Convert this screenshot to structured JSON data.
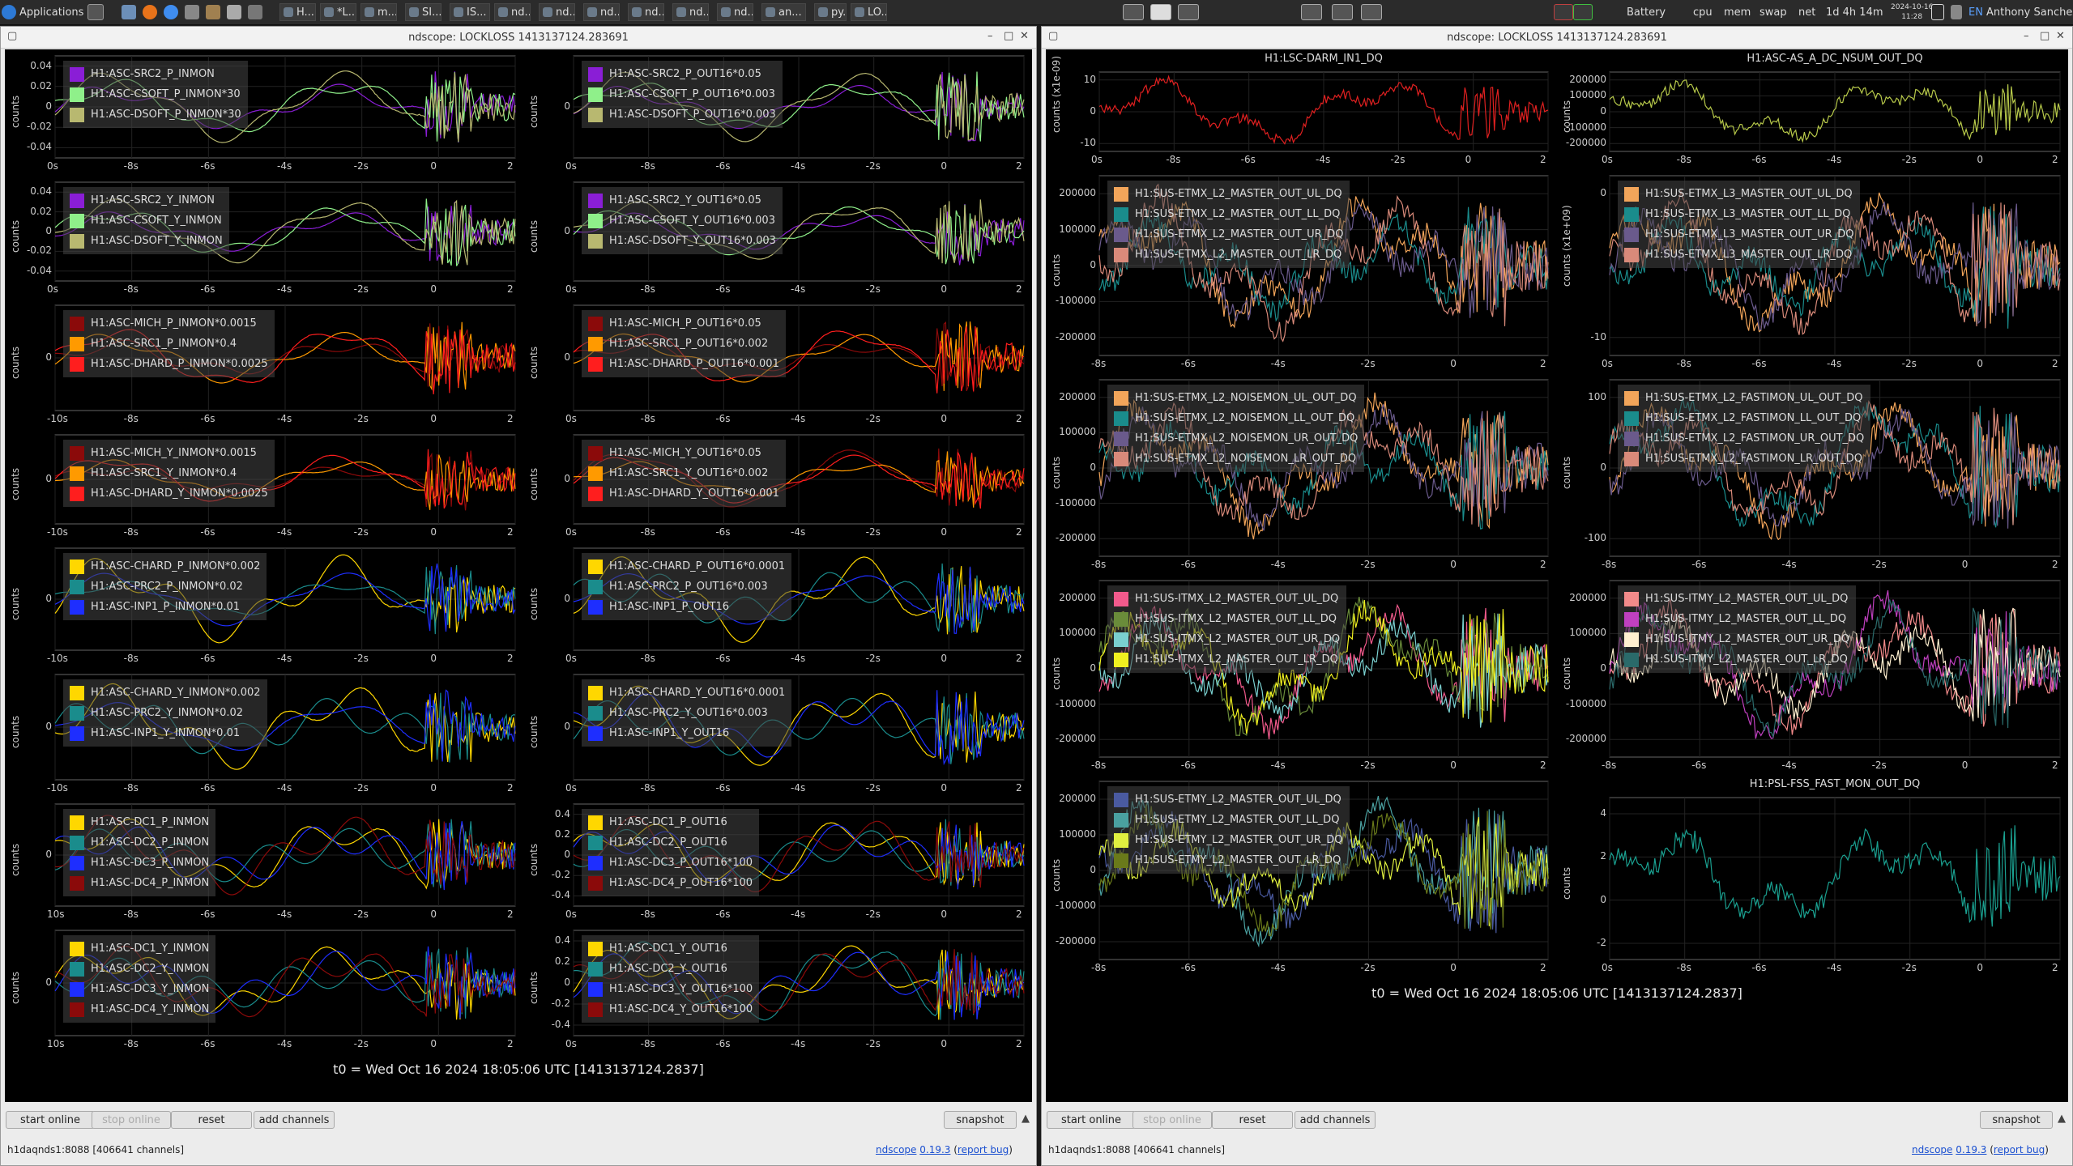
{
  "taskbar": {
    "apps_label": "Applications",
    "tasks": [
      "H...",
      "*L...",
      "m...",
      "SI...",
      "IS...",
      "nd...",
      "nd...",
      "nd...",
      "nd...",
      "nd...",
      "nd...",
      "an...",
      "py...",
      "LO..."
    ],
    "indicators": [
      "Battery",
      "cpu",
      "mem",
      "swap",
      "net"
    ],
    "uptime": "1d 4h 14m",
    "date": "2024-10-16",
    "time": "11:28",
    "lang": "EN",
    "user": "Anthony Sanchez"
  },
  "windows": [
    {
      "title": "ndscope: LOCKLOSS 1413137124.283691",
      "t0": "t0 = Wed Oct 16 2024 18:05:06 UTC [1413137124.2837]",
      "buttons": {
        "start": "start online",
        "stop": "stop online",
        "reset": "reset",
        "add": "add channels",
        "snapshot": "snapshot"
      },
      "status": {
        "server": "h1daqnds1:8088  [406641 channels]",
        "app": "ndscope",
        "version": "0.19.3",
        "report": "report bug"
      },
      "panels": [
        {
          "ylabel": "counts",
          "yticks": [
            "0.04",
            "0.02",
            "0",
            "-0.02",
            "-0.04"
          ],
          "xticks": [
            "0s",
            "-8s",
            "-6s",
            "-4s",
            "-2s",
            "0",
            "2"
          ],
          "legend": [
            "H1:ASC-SRC2_P_INMON",
            "H1:ASC-CSOFT_P_INMON*30",
            "H1:ASC-DSOFT_P_INMON*30"
          ],
          "colors": [
            "#8a1ed6",
            "#8ff08a",
            "#b8b870"
          ]
        },
        {
          "ylabel": "counts",
          "yticks": [
            "0"
          ],
          "xticks": [
            "0s",
            "-8s",
            "-6s",
            "-4s",
            "-2s",
            "0",
            "2"
          ],
          "legend": [
            "H1:ASC-SRC2_P_OUT16*0.05",
            "H1:ASC-CSOFT_P_OUT16*0.003",
            "H1:ASC-DSOFT_P_OUT16*0.003"
          ],
          "colors": [
            "#8a1ed6",
            "#8ff08a",
            "#b8b870"
          ]
        },
        {
          "ylabel": "counts",
          "yticks": [
            "0.04",
            "0.02",
            "0",
            "-0.02",
            "-0.04"
          ],
          "xticks": [
            "0s",
            "-8s",
            "-6s",
            "-4s",
            "-2s",
            "0",
            "2"
          ],
          "legend": [
            "H1:ASC-SRC2_Y_INMON",
            "H1:ASC-CSOFT_Y_INMON",
            "H1:ASC-DSOFT_Y_INMON"
          ],
          "colors": [
            "#8a1ed6",
            "#8ff08a",
            "#b8b870"
          ]
        },
        {
          "ylabel": "counts",
          "yticks": [
            "0"
          ],
          "xticks": [
            "0s",
            "-8s",
            "-6s",
            "-4s",
            "-2s",
            "0",
            "2"
          ],
          "legend": [
            "H1:ASC-SRC2_Y_OUT16*0.05",
            "H1:ASC-CSOFT_Y_OUT16*0.003",
            "H1:ASC-DSOFT_Y_OUT16*0.003"
          ],
          "colors": [
            "#8a1ed6",
            "#8ff08a",
            "#b8b870"
          ]
        },
        {
          "ylabel": "counts",
          "yticks": [
            "0"
          ],
          "xticks": [
            "-10s",
            "-8s",
            "-6s",
            "-4s",
            "-2s",
            "0",
            "2"
          ],
          "legend": [
            "H1:ASC-MICH_P_INMON*0.0015",
            "H1:ASC-SRC1_P_INMON*0.4",
            "H1:ASC-DHARD_P_INMON*0.0025"
          ],
          "colors": [
            "#8b0a0a",
            "#ff9a00",
            "#ff1e1e"
          ]
        },
        {
          "ylabel": "counts",
          "yticks": [
            "0"
          ],
          "xticks": [
            "0s",
            "-8s",
            "-6s",
            "-4s",
            "-2s",
            "0",
            "2"
          ],
          "legend": [
            "H1:ASC-MICH_P_OUT16*0.05",
            "H1:ASC-SRC1_P_OUT16*0.002",
            "H1:ASC-DHARD_P_OUT16*0.001"
          ],
          "colors": [
            "#8b0a0a",
            "#ff9a00",
            "#ff1e1e"
          ]
        },
        {
          "ylabel": "counts",
          "yticks": [
            "0"
          ],
          "xticks": [
            "-10s",
            "-8s",
            "-6s",
            "-4s",
            "-2s",
            "0",
            "2"
          ],
          "legend": [
            "H1:ASC-MICH_Y_INMON*0.0015",
            "H1:ASC-SRC1_Y_INMON*0.4",
            "H1:ASC-DHARD_Y_INMON*0.0025"
          ],
          "colors": [
            "#8b0a0a",
            "#ff9a00",
            "#ff1e1e"
          ]
        },
        {
          "ylabel": "counts",
          "yticks": [
            "0"
          ],
          "xticks": [
            "0s",
            "-8s",
            "-6s",
            "-4s",
            "-2s",
            "0",
            "2"
          ],
          "legend": [
            "H1:ASC-MICH_Y_OUT16*0.05",
            "H1:ASC-SRC1_Y_OUT16*0.002",
            "H1:ASC-DHARD_Y_OUT16*0.001"
          ],
          "colors": [
            "#8b0a0a",
            "#ff9a00",
            "#ff1e1e"
          ]
        },
        {
          "ylabel": "counts",
          "yticks": [
            "0"
          ],
          "xticks": [
            "-10s",
            "-8s",
            "-6s",
            "-4s",
            "-2s",
            "0",
            "2"
          ],
          "legend": [
            "H1:ASC-CHARD_P_INMON*0.002",
            "H1:ASC-PRC2_P_INMON*0.02",
            "H1:ASC-INP1_P_INMON*0.01"
          ],
          "colors": [
            "#ffd700",
            "#1a8c8c",
            "#1e2eff"
          ]
        },
        {
          "ylabel": "counts",
          "yticks": [
            "0"
          ],
          "xticks": [
            "0s",
            "-8s",
            "-6s",
            "-4s",
            "-2s",
            "0",
            "2"
          ],
          "legend": [
            "H1:ASC-CHARD_P_OUT16*0.0001",
            "H1:ASC-PRC2_P_OUT16*0.003",
            "H1:ASC-INP1_P_OUT16"
          ],
          "colors": [
            "#ffd700",
            "#1a8c8c",
            "#1e2eff"
          ]
        },
        {
          "ylabel": "counts",
          "yticks": [
            "0"
          ],
          "xticks": [
            "-10s",
            "-8s",
            "-6s",
            "-4s",
            "-2s",
            "0",
            "2"
          ],
          "legend": [
            "H1:ASC-CHARD_Y_INMON*0.002",
            "H1:ASC-PRC2_Y_INMON*0.02",
            "H1:ASC-INP1_Y_INMON*0.01"
          ],
          "colors": [
            "#ffd700",
            "#1a8c8c",
            "#1e2eff"
          ]
        },
        {
          "ylabel": "counts",
          "yticks": [
            "0"
          ],
          "xticks": [
            "0s",
            "-8s",
            "-6s",
            "-4s",
            "-2s",
            "0",
            "2"
          ],
          "legend": [
            "H1:ASC-CHARD_Y_OUT16*0.0001",
            "H1:ASC-PRC2_Y_OUT16*0.003",
            "H1:ASC-INP1_Y_OUT16"
          ],
          "colors": [
            "#ffd700",
            "#1a8c8c",
            "#1e2eff"
          ]
        },
        {
          "ylabel": "counts",
          "yticks": [
            "0"
          ],
          "xticks": [
            "10s",
            "-8s",
            "-6s",
            "-4s",
            "-2s",
            "0",
            "2"
          ],
          "legend": [
            "H1:ASC-DC1_P_INMON",
            "H1:ASC-DC2_P_INMON",
            "H1:ASC-DC3_P_INMON",
            "H1:ASC-DC4_P_INMON"
          ],
          "colors": [
            "#ffd700",
            "#1a8c8c",
            "#1e2eff",
            "#8b0a0a"
          ]
        },
        {
          "ylabel": "counts",
          "yticks": [
            "0.4",
            "0.2",
            "0",
            "-0.2",
            "-0.4"
          ],
          "xticks": [
            "0s",
            "-8s",
            "-6s",
            "-4s",
            "-2s",
            "0",
            "2"
          ],
          "legend": [
            "H1:ASC-DC1_P_OUT16",
            "H1:ASC-DC2_P_OUT16",
            "H1:ASC-DC3_P_OUT16*100",
            "H1:ASC-DC4_P_OUT16*100"
          ],
          "colors": [
            "#ffd700",
            "#1a8c8c",
            "#1e2eff",
            "#8b0a0a"
          ]
        },
        {
          "ylabel": "counts",
          "yticks": [
            "0"
          ],
          "xticks": [
            "10s",
            "-8s",
            "-6s",
            "-4s",
            "-2s",
            "0",
            "2"
          ],
          "legend": [
            "H1:ASC-DC1_Y_INMON",
            "H1:ASC-DC2_Y_INMON",
            "H1:ASC-DC3_Y_INMON",
            "H1:ASC-DC4_Y_INMON"
          ],
          "colors": [
            "#ffd700",
            "#1a8c8c",
            "#1e2eff",
            "#8b0a0a"
          ]
        },
        {
          "ylabel": "counts",
          "yticks": [
            "0.4",
            "0.2",
            "0",
            "-0.2",
            "-0.4"
          ],
          "xticks": [
            "0s",
            "-8s",
            "-6s",
            "-4s",
            "-2s",
            "0",
            "2"
          ],
          "legend": [
            "H1:ASC-DC1_Y_OUT16",
            "H1:ASC-DC2_Y_OUT16",
            "H1:ASC-DC3_Y_OUT16*100",
            "H1:ASC-DC4_Y_OUT16*100"
          ],
          "colors": [
            "#ffd700",
            "#1a8c8c",
            "#1e2eff",
            "#8b0a0a"
          ]
        }
      ]
    },
    {
      "title": "ndscope: LOCKLOSS 1413137124.283691",
      "t0": "t0 = Wed Oct 16 2024 18:05:06 UTC [1413137124.2837]",
      "buttons": {
        "start": "start online",
        "stop": "stop online",
        "reset": "reset",
        "add": "add channels",
        "snapshot": "snapshot"
      },
      "status": {
        "server": "h1daqnds1:8088  [406641 channels]",
        "app": "ndscope",
        "version": "0.19.3",
        "report": "report bug"
      },
      "panels": [
        {
          "title": "H1:LSC-DARM_IN1_DQ",
          "ylabel": "counts (x1e-09)",
          "yticks": [
            "10",
            "0",
            "-10"
          ],
          "xticks": [
            "0s",
            "-8s",
            "-6s",
            "-4s",
            "-2s",
            "0",
            "2"
          ],
          "legend": [],
          "colors": [
            "#e02020"
          ]
        },
        {
          "title": "H1:ASC-AS_A_DC_NSUM_OUT_DQ",
          "ylabel": "counts",
          "yticks": [
            "200000",
            "100000",
            "0",
            "-100000",
            "-200000"
          ],
          "xticks": [
            "0s",
            "-8s",
            "-6s",
            "-4s",
            "-2s",
            "0",
            "2"
          ],
          "legend": [],
          "colors": [
            "#b7c94a"
          ]
        },
        {
          "ylabel": "counts",
          "yticks": [
            "200000",
            "100000",
            "0",
            "-100000",
            "-200000"
          ],
          "xticks": [
            "-8s",
            "-6s",
            "-4s",
            "-2s",
            "0",
            "2"
          ],
          "legend": [
            "H1:SUS-ETMX_L2_MASTER_OUT_UL_DQ",
            "H1:SUS-ETMX_L2_MASTER_OUT_LL_DQ",
            "H1:SUS-ETMX_L2_MASTER_OUT_UR_DQ",
            "H1:SUS-ETMX_L2_MASTER_OUT_LR_DQ"
          ],
          "colors": [
            "#f2a55a",
            "#1a8c8c",
            "#6a5a8c",
            "#d98a7a"
          ]
        },
        {
          "ylabel": "counts (x1e+09)",
          "yticks": [
            "0",
            "-10"
          ],
          "xticks": [
            "0s",
            "-8s",
            "-6s",
            "-4s",
            "-2s",
            "0",
            "2"
          ],
          "legend": [
            "H1:SUS-ETMX_L3_MASTER_OUT_UL_DQ",
            "H1:SUS-ETMX_L3_MASTER_OUT_LL_DQ",
            "H1:SUS-ETMX_L3_MASTER_OUT_UR_DQ",
            "H1:SUS-ETMX_L3_MASTER_OUT_LR_DQ"
          ],
          "colors": [
            "#f2a55a",
            "#1a8c8c",
            "#6a5a8c",
            "#d98a7a"
          ]
        },
        {
          "ylabel": "counts",
          "yticks": [
            "200000",
            "100000",
            "0",
            "-100000",
            "-200000"
          ],
          "xticks": [
            "-8s",
            "-6s",
            "-4s",
            "-2s",
            "0",
            "2"
          ],
          "legend": [
            "H1:SUS-ETMX_L2_NOISEMON_UL_OUT_DQ",
            "H1:SUS-ETMX_L2_NOISEMON_LL_OUT_DQ",
            "H1:SUS-ETMX_L2_NOISEMON_UR_OUT_DQ",
            "H1:SUS-ETMX_L2_NOISEMON_LR_OUT_DQ"
          ],
          "colors": [
            "#f2a55a",
            "#1a8c8c",
            "#6a5a8c",
            "#d98a7a"
          ]
        },
        {
          "ylabel": "counts",
          "yticks": [
            "100",
            "0",
            "-100"
          ],
          "xticks": [
            "-8s",
            "-6s",
            "-4s",
            "-2s",
            "0",
            "2"
          ],
          "legend": [
            "H1:SUS-ETMX_L2_FASTIMON_UL_OUT_DQ",
            "H1:SUS-ETMX_L2_FASTIMON_LL_OUT_DQ",
            "H1:SUS-ETMX_L2_FASTIMON_UR_OUT_DQ",
            "H1:SUS-ETMX_L2_FASTIMON_LR_OUT_DQ"
          ],
          "colors": [
            "#f2a55a",
            "#1a8c8c",
            "#6a5a8c",
            "#d98a7a"
          ]
        },
        {
          "ylabel": "counts",
          "yticks": [
            "200000",
            "100000",
            "0",
            "-100000",
            "-200000"
          ],
          "xticks": [
            "-8s",
            "-6s",
            "-4s",
            "-2s",
            "0",
            "2"
          ],
          "legend": [
            "H1:SUS-ITMX_L2_MASTER_OUT_UL_DQ",
            "H1:SUS-ITMX_L2_MASTER_OUT_LL_DQ",
            "H1:SUS-ITMX_L2_MASTER_OUT_UR_DQ",
            "H1:SUS-ITMX_L2_MASTER_OUT_LR_DQ"
          ],
          "colors": [
            "#f25a8c",
            "#6a8c3a",
            "#7ad0d0",
            "#f0f020"
          ]
        },
        {
          "ylabel": "counts",
          "yticks": [
            "200000",
            "100000",
            "0",
            "-100000",
            "-200000"
          ],
          "xticks": [
            "-8s",
            "-6s",
            "-4s",
            "-2s",
            "0",
            "2"
          ],
          "legend": [
            "H1:SUS-ITMY_L2_MASTER_OUT_UL_DQ",
            "H1:SUS-ITMY_L2_MASTER_OUT_LL_DQ",
            "H1:SUS-ITMY_L2_MASTER_OUT_UR_DQ",
            "H1:SUS-ITMY_L2_MASTER_OUT_LR_DQ"
          ],
          "colors": [
            "#f28a8a",
            "#c040c0",
            "#fff0d0",
            "#2a6a6a"
          ]
        },
        {
          "ylabel": "counts",
          "yticks": [
            "200000",
            "100000",
            "0",
            "-100000",
            "-200000"
          ],
          "xticks": [
            "-8s",
            "-6s",
            "-4s",
            "-2s",
            "0",
            "2"
          ],
          "legend": [
            "H1:SUS-ETMY_L2_MASTER_OUT_UL_DQ",
            "H1:SUS-ETMY_L2_MASTER_OUT_LL_DQ",
            "H1:SUS-ETMY_L2_MASTER_OUT_UR_DQ",
            "H1:SUS-ETMY_L2_MASTER_OUT_LR_DQ"
          ],
          "colors": [
            "#4a5aa0",
            "#4aa0a0",
            "#e0f040",
            "#6a7a1a"
          ]
        },
        {
          "title": "H1:PSL-FSS_FAST_MON_OUT_DQ",
          "ylabel": "counts",
          "yticks": [
            "4",
            "2",
            "0",
            "-2"
          ],
          "xticks": [
            "0s",
            "-8s",
            "-6s",
            "-4s",
            "-2s",
            "0",
            "2"
          ],
          "legend": [],
          "colors": [
            "#1aa090"
          ]
        }
      ]
    }
  ]
}
